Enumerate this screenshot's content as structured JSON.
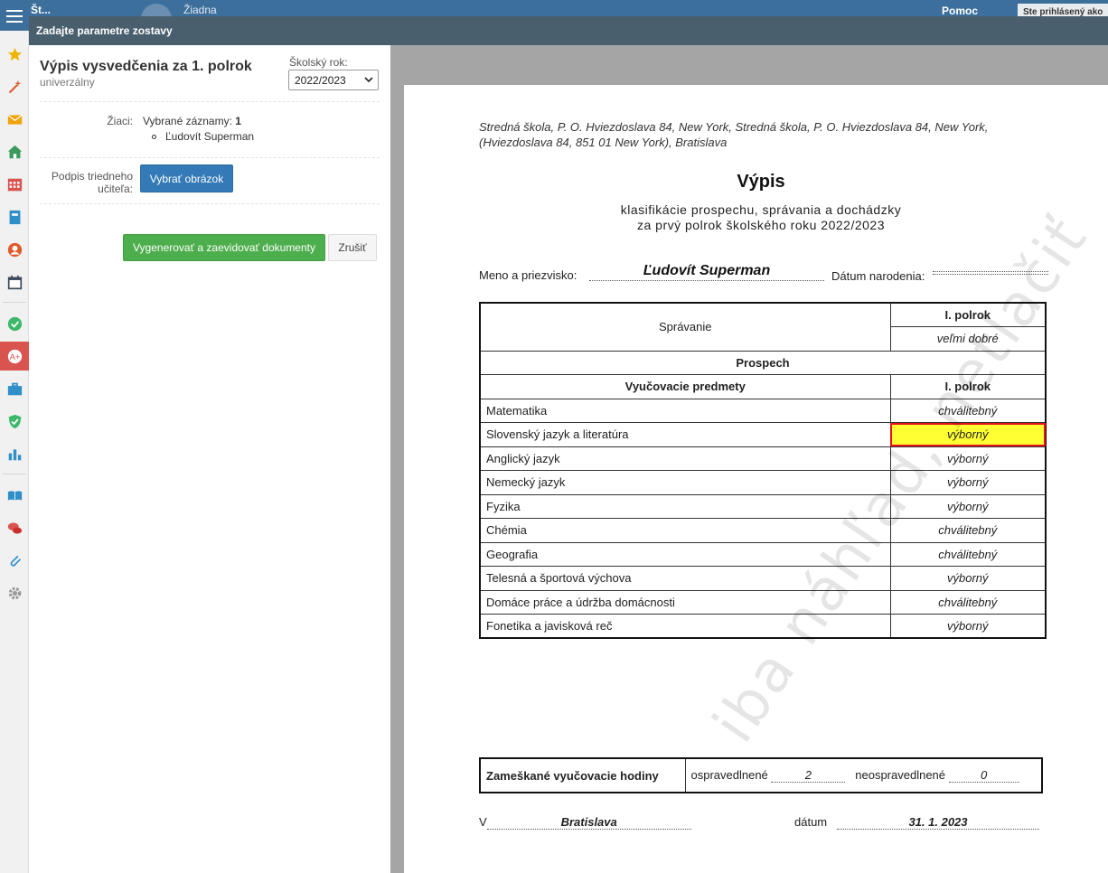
{
  "topbar": {
    "item1": "Št...",
    "item2": "Žiadna",
    "help": "Pomoc",
    "login_status": "Ste prihlásený ako"
  },
  "dialog": {
    "header": "Zadajte parametre zostavy"
  },
  "params": {
    "report_title": "Výpis vysvedčenia za 1. polrok",
    "report_subtitle": "univerzálny",
    "year_label": "Školský rok:",
    "year_value": "2022/2023",
    "students_label": "Žiaci:",
    "selected_label": "Vybrané záznamy:",
    "selected_count": "1",
    "student_name": "Ľudovít Superman",
    "signature_label_1": "Podpis triedneho",
    "signature_label_2": "učiteľa:",
    "pick_image_label": "Vybrať obrázok",
    "generate_label": "Vygenerovať a zaevidovať dokumenty",
    "cancel_label": "Zrušiť"
  },
  "document": {
    "school": "Stredná škola, P. O. Hviezdoslava 84, New York, Stredná škola, P. O. Hviezdoslava 84, New York, (Hviezdoslava 84, 851 01 New York), Bratislava",
    "title": "Výpis",
    "subtitle1": "klasifikácie prospechu, správania a dochádzky",
    "subtitle2": "za prvý polrok školského roku 2022/2023",
    "name_label": "Meno a priezvisko:",
    "name_value": "Ľudovít Superman",
    "birth_label": "Dátum narodenia:",
    "behaviour_label": "Správanie",
    "term_label": "I. polrok",
    "behaviour_value": "veľmi dobré",
    "results_label": "Prospech",
    "subjects_label": "Vyučovacie predmety",
    "subjects": [
      {
        "name": "Matematika",
        "grade": "chválitebný"
      },
      {
        "name": "Slovenský jazyk a literatúra",
        "grade": "výborný"
      },
      {
        "name": "Anglický jazyk",
        "grade": "výborný"
      },
      {
        "name": "Nemecký jazyk",
        "grade": "výborný"
      },
      {
        "name": "Fyzika",
        "grade": "výborný"
      },
      {
        "name": "Chémia",
        "grade": "chválitebný"
      },
      {
        "name": "Geografia",
        "grade": "chválitebný"
      },
      {
        "name": "Telesná a športová výchova",
        "grade": "výborný"
      },
      {
        "name": "Domáce práce a údržba domácnosti",
        "grade": "chválitebný"
      },
      {
        "name": "Fonetika a javisková reč",
        "grade": "výborný"
      }
    ],
    "absence_label": "Zameškané vyučovacie hodiny",
    "excused_label": "ospravedlnené",
    "excused_value": "2",
    "unexcused_label": "neospravedlnené",
    "unexcused_value": "0",
    "place_label": "V",
    "place_value": "Bratislava",
    "date_label": "dátum",
    "date_value": "31. 1. 2023",
    "watermark": "iba náhľad, netlačiť"
  },
  "colors": {
    "topbar": "#3d6f9c",
    "dialog_header": "#4a5f6e",
    "primary_button": "#337ab7",
    "success_button": "#4cae4c",
    "highlight": "#ffff33",
    "highlight_border": "#e8101a"
  },
  "rail_icons": [
    "star-icon",
    "magic-wand-icon",
    "envelope-icon",
    "home-icon",
    "calendar-grid-icon",
    "notebook-icon",
    "user-circle-icon",
    "calendar-icon",
    "check-circle-icon",
    "grades-a-plus-icon",
    "briefcase-icon",
    "shield-check-icon",
    "bar-chart-icon",
    "open-book-icon",
    "chat-bubbles-icon",
    "paperclip-icon",
    "gear-icon"
  ]
}
